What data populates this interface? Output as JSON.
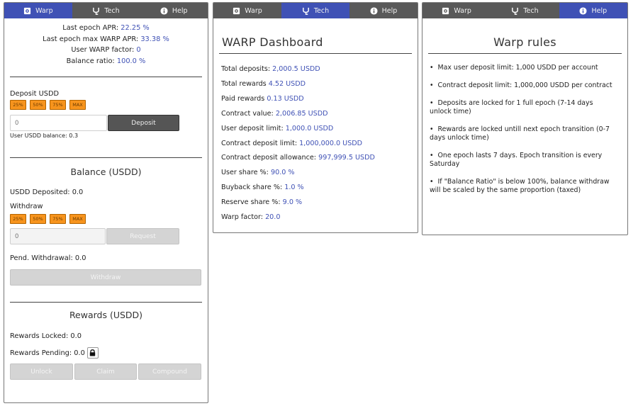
{
  "tabs": [
    {
      "label": "Warp",
      "icon": "warp-icon"
    },
    {
      "label": "Tech",
      "icon": "tech-icon"
    },
    {
      "label": "Help",
      "icon": "info-icon"
    }
  ],
  "left": {
    "stats": [
      {
        "label": "Last epoch APR:",
        "value": "22.25 %"
      },
      {
        "label": "Last epoch max WARP APR:",
        "value": "33.38 %"
      },
      {
        "label": "User WARP factor:",
        "value": "0"
      },
      {
        "label": "Balance ratio:",
        "value": "100.0 %"
      }
    ],
    "deposit": {
      "label": "Deposit USDD",
      "percents": [
        "25%",
        "50%",
        "75%",
        "MAX"
      ],
      "placeholder": "0",
      "button": "Deposit",
      "balance": "User USDD balance: 0.3"
    },
    "balance": {
      "title": "Balance (USDD)",
      "deposited": "USDD Deposited: 0.0",
      "withdraw_label": "Withdraw",
      "percents": [
        "25%",
        "50%",
        "75%",
        "MAX"
      ],
      "placeholder": "0",
      "request_button": "Request",
      "pending": "Pend. Withdrawal: 0.0",
      "withdraw_button": "Withdraw"
    },
    "rewards": {
      "title": "Rewards (USDD)",
      "locked": "Rewards Locked: 0.0",
      "pending": "Rewards Pending: 0.0",
      "unlock": "Unlock",
      "claim": "Claim",
      "compound": "Compound"
    }
  },
  "dashboard": {
    "title": "WARP Dashboard",
    "rows": [
      {
        "label": "Total deposits:",
        "value": "2,000.5 USDD"
      },
      {
        "label": "Total rewards",
        "value": "4.52 USDD"
      },
      {
        "label": "Paid rewards",
        "value": "0.13 USDD"
      },
      {
        "label": "Contract value:",
        "value": "2,006.85 USDD"
      },
      {
        "label": "User deposit limit:",
        "value": "1,000.0 USDD"
      },
      {
        "label": "Contract deposit limit:",
        "value": "1,000,000.0 USDD"
      },
      {
        "label": "Contract deposit allowance:",
        "value": "997,999.5 USDD"
      },
      {
        "label": "User share %:",
        "value": "90.0 %"
      },
      {
        "label": "Buyback share %:",
        "value": "1.0 %"
      },
      {
        "label": "Reserve share %:",
        "value": "9.0 %"
      },
      {
        "label": "Warp factor:",
        "value": "20.0"
      }
    ]
  },
  "rules": {
    "title": "Warp rules",
    "items": [
      "Max user deposit limit: 1,000 USDD per account",
      "Contract deposit limit: 1,000,000 USDD per contract",
      "Deposits are locked for 1 full epoch (7-14 days unlock time)",
      "Rewards are locked untill next epoch transition (0-7 days unlock time)",
      "One epoch lasts 7 days. Epoch transition is every Saturday",
      "If \"Balance Ratio\" is below 100%, balance withdraw will be scaled by the same proportion (taxed)"
    ]
  },
  "colors": {
    "tab_active": "#3f51b5",
    "tab_bg": "#595959",
    "accent": "#3f51b5",
    "percent_button": "#f7941d"
  }
}
